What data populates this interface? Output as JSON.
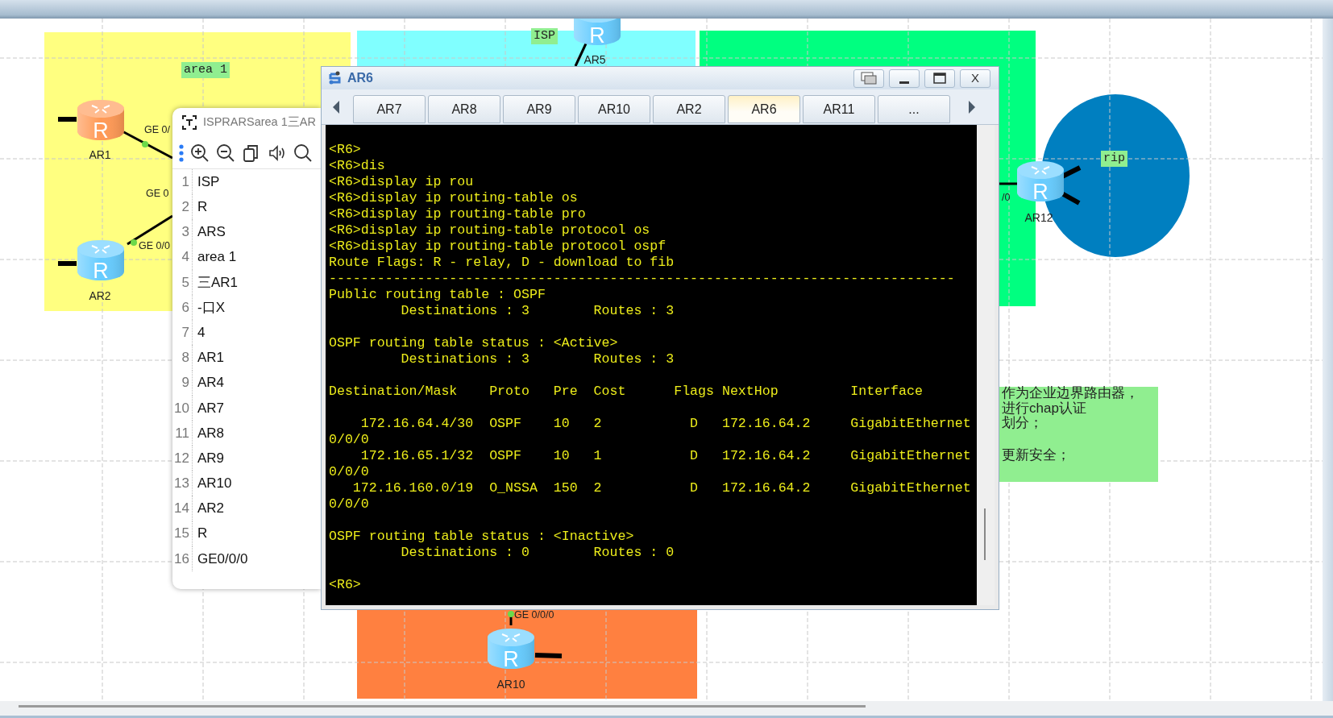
{
  "areas": [
    {
      "kind": "rect",
      "color": "#ffff80",
      "label": "area 1"
    },
    {
      "kind": "rect",
      "color": "#80ffff",
      "label": "ISP"
    },
    {
      "kind": "rect",
      "color": "#00ff80"
    },
    {
      "kind": "ellipse",
      "color": "#007fc0",
      "label": "rip"
    },
    {
      "kind": "rect",
      "color": "#ff8040"
    }
  ],
  "routers": [
    {
      "name": "AR1",
      "color": "#ff9955",
      "glyph": "R"
    },
    {
      "name": "AR2",
      "color": "#66ccff",
      "glyph": "R"
    },
    {
      "name": "AR5",
      "color": "#66ccff",
      "glyph": "R"
    },
    {
      "name": "AR12",
      "color": "#66ccff",
      "glyph": "R"
    },
    {
      "name": "AR10",
      "color": "#66ccff",
      "glyph": "R"
    }
  ],
  "port_labels": [
    "GE 0/",
    "GE 0",
    "GE 0/0",
    "/0",
    "GE 0/0/0"
  ],
  "note": {
    "color": "#90ee90",
    "lines": [
      "作为企业边界路由器，",
      "进行chap认证",
      "划分；",
      "更新安全；"
    ]
  },
  "ocr_panel": {
    "title": "ISPRARSarea 1三AR",
    "lines": [
      {
        "number": "1",
        "text": "ISP"
      },
      {
        "number": "2",
        "text": "R"
      },
      {
        "number": "3",
        "text": "ARS"
      },
      {
        "number": "4",
        "text": "area 1"
      },
      {
        "number": "5",
        "text": "三AR1"
      },
      {
        "number": "6",
        "text": "-口X"
      },
      {
        "number": "7",
        "text": "4"
      },
      {
        "number": "8",
        "text": "AR1"
      },
      {
        "number": "9",
        "text": "AR4"
      },
      {
        "number": "10",
        "text": "AR7"
      },
      {
        "number": "11",
        "text": "AR8"
      },
      {
        "number": "12",
        "text": "AR9"
      },
      {
        "number": "13",
        "text": "AR10"
      },
      {
        "number": "14",
        "text": "AR2"
      },
      {
        "number": "15",
        "text": "R"
      },
      {
        "number": "16",
        "text": "GE0/0/0"
      }
    ]
  },
  "terminal": {
    "title": "AR6",
    "close": "X",
    "tabs": [
      {
        "label": "AR7",
        "selected": false
      },
      {
        "label": "AR8",
        "selected": false
      },
      {
        "label": "AR9",
        "selected": false
      },
      {
        "label": "AR10",
        "selected": false
      },
      {
        "label": "AR2",
        "selected": false
      },
      {
        "label": "AR6",
        "selected": true
      },
      {
        "label": "AR11",
        "selected": false
      },
      {
        "label": "...",
        "selected": false
      }
    ],
    "lines": [
      {
        "text": "<R6>",
        "blank_before": false
      },
      {
        "text": "<R6>dis",
        "blank_before": false
      },
      {
        "text": "<R6>display ip rou",
        "blank_before": false
      },
      {
        "text": "<R6>display ip routing-table os",
        "blank_before": false
      },
      {
        "text": "<R6>display ip routing-table pro",
        "blank_before": false
      },
      {
        "text": "<R6>display ip routing-table protocol os",
        "blank_before": false
      },
      {
        "text": "<R6>display ip routing-table protocol ospf",
        "blank_before": false
      },
      {
        "text": "Route Flags: R - relay, D - download to fib",
        "blank_before": false
      },
      {
        "text": "------------------------------------------------------------------------------",
        "blank_before": false
      },
      {
        "text": "Public routing table : OSPF",
        "blank_before": false
      },
      {
        "text": "         Destinations : 3        Routes : 3",
        "blank_before": false
      },
      {
        "text": "OSPF routing table status : <Active>",
        "blank_before": true
      },
      {
        "text": "         Destinations : 3        Routes : 3",
        "blank_before": false
      },
      {
        "text": "Destination/Mask    Proto   Pre  Cost      Flags NextHop         Interface",
        "blank_before": true
      },
      {
        "text": "    172.16.64.4/30  OSPF    10   2           D   172.16.64.2     GigabitEthernet",
        "blank_before": true
      },
      {
        "text": "0/0/0",
        "blank_before": false
      },
      {
        "text": "    172.16.65.1/32  OSPF    10   1           D   172.16.64.2     GigabitEthernet",
        "blank_before": false
      },
      {
        "text": "0/0/0",
        "blank_before": false
      },
      {
        "text": "   172.16.160.0/19  O_NSSA  150  2           D   172.16.64.2     GigabitEthernet",
        "blank_before": false
      },
      {
        "text": "0/0/0",
        "blank_before": false
      },
      {
        "text": "OSPF routing table status : <Inactive>",
        "blank_before": true
      },
      {
        "text": "         Destinations : 0        Routes : 0",
        "blank_before": false
      },
      {
        "text": "<R6>",
        "blank_before": true
      }
    ]
  }
}
